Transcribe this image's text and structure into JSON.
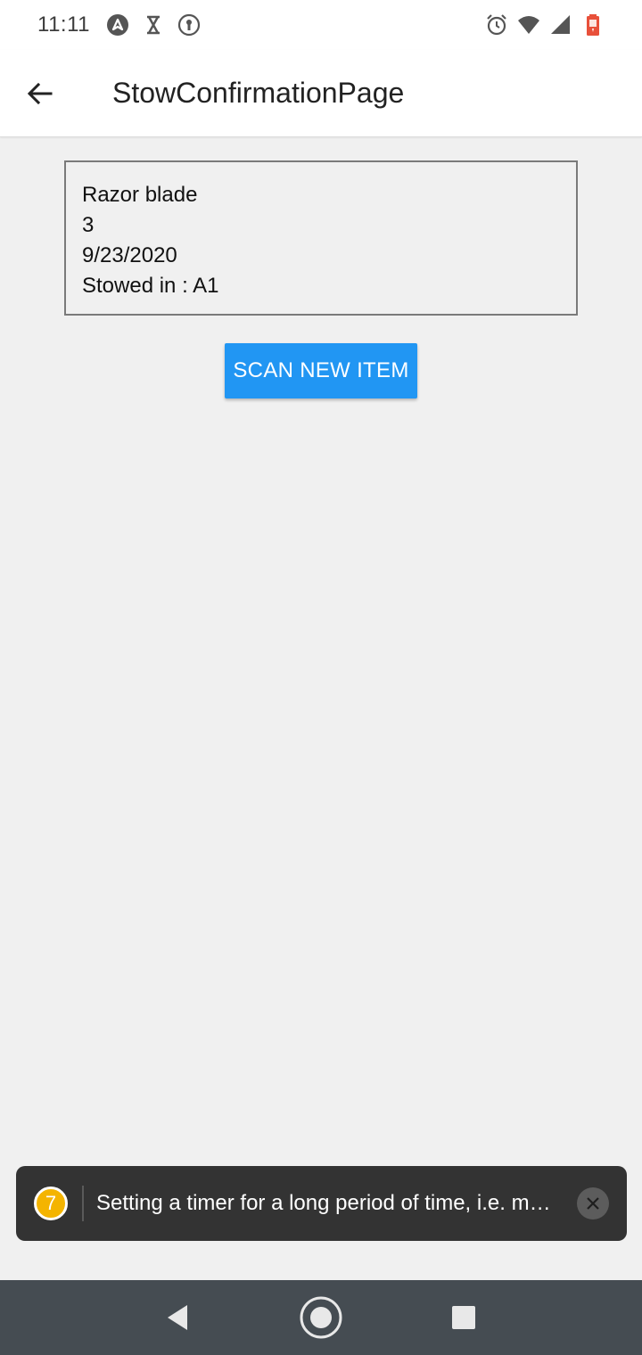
{
  "status_bar": {
    "time": "11:11",
    "left_icons": [
      "nav-arrow-icon",
      "hourglass-icon",
      "keyhole-icon"
    ],
    "right_icons": [
      "alarm-icon",
      "wifi-icon",
      "signal-icon",
      "battery-icon"
    ]
  },
  "app_bar": {
    "title": "StowConfirmationPage"
  },
  "item": {
    "name": "Razor blade",
    "quantity": "3",
    "date": "9/23/2020",
    "location": "Stowed in : A1"
  },
  "actions": {
    "scan_new_item_label": "SCAN NEW ITEM"
  },
  "toast": {
    "count": "7",
    "message": "Setting a timer for a long period of time, i.e. multiple minutes, is a performance and correctness issue on Android"
  },
  "colors": {
    "accent": "#2196f3",
    "toast_badge": "#f4b400",
    "nav_bar": "#454c52",
    "battery": "#e8503a"
  }
}
